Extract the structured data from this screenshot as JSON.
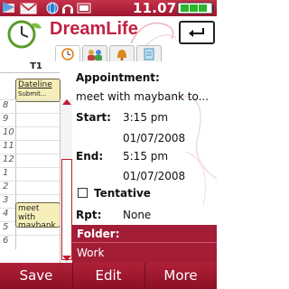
{
  "status": {
    "time": "11.07"
  },
  "app": {
    "title": "DreamLife"
  },
  "tabs": [
    {
      "icon": "clock-icon",
      "active": true
    },
    {
      "icon": "people-icon",
      "active": false
    },
    {
      "icon": "bell-icon",
      "active": false
    },
    {
      "icon": "note-icon",
      "active": false
    }
  ],
  "timeline": {
    "day": "T1",
    "hours": [
      "8",
      "9",
      "10",
      "11",
      "12",
      "1",
      "2",
      "3",
      "4",
      "5",
      "6"
    ],
    "events": [
      {
        "title": "Dateline",
        "subtitle": "Submit..."
      },
      {
        "title": "meet with maybank to",
        "subtitle": ""
      }
    ]
  },
  "detail": {
    "type_label": "Appointment:",
    "subject": "meet with maybank to...",
    "start_label": "Start:",
    "start_time": "3:15 pm",
    "start_date": "01/07/2008",
    "end_label": "End:",
    "end_time": "5:15 pm",
    "end_date": "01/07/2008",
    "tentative_label": "Tentative",
    "tentative_checked": false,
    "repeat_label": "Rpt:",
    "repeat_value": "None",
    "folder_label": "Folder:",
    "folder_value": "Work"
  },
  "softkeys": {
    "left": "Save",
    "middle": "Edit",
    "right": "More"
  },
  "colors": {
    "accent": "#a31d37",
    "event_bg": "#f6eeb9"
  }
}
